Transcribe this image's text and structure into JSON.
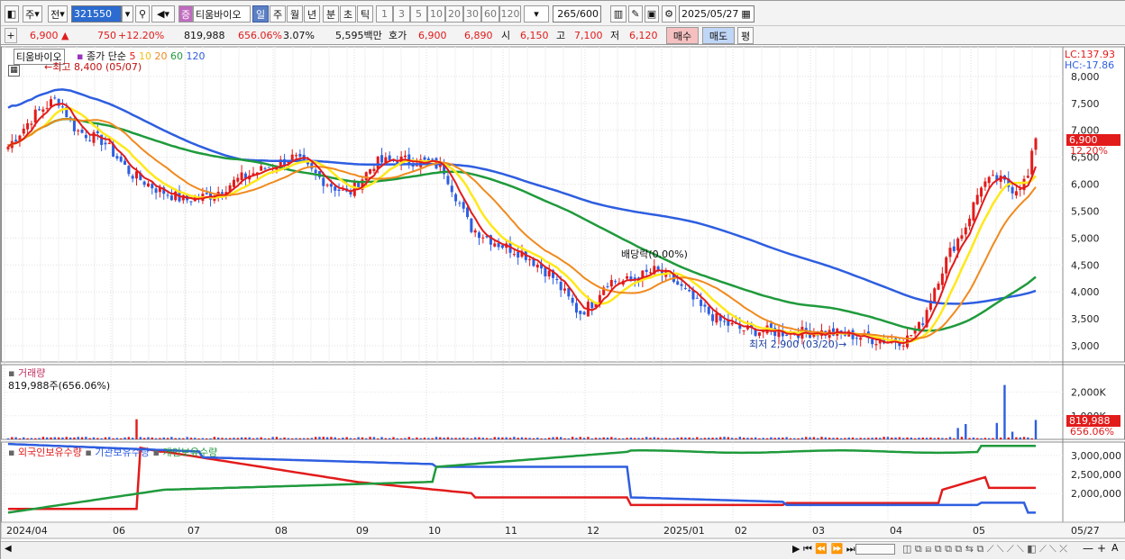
{
  "toolbar": {
    "type_label": "주",
    "period_label": "전",
    "code": "321550",
    "stock_name": "티움바이오",
    "badge": "증",
    "tf_day": "일",
    "tf_week": "주",
    "tf_month": "월",
    "tf_year": "년",
    "tf_min": "분",
    "tf_sec": "초",
    "tf_tick": "틱",
    "intervals": [
      "1",
      "3",
      "5",
      "10",
      "20",
      "30",
      "60",
      "120"
    ],
    "count": "265",
    "count_total": "/600",
    "date": "2025/05/27"
  },
  "quote": {
    "price": "6,900",
    "arrow": "▲",
    "change": "750",
    "change_pct": "+12.20%",
    "volume": "819,988",
    "vol_pct": "656.06%",
    "turnover": "3.07%",
    "amount": "5,595백만",
    "hoga_label": "호가",
    "hoga_ask": "6,900",
    "hoga_bid": "6,890",
    "open_label": "시",
    "open": "6,150",
    "high_label": "고",
    "high": "7,100",
    "low_label": "저",
    "low": "6,120",
    "buy_label": "매수",
    "sell_label": "매도",
    "eval_label": "평"
  },
  "price_panel": {
    "name": "티움바이오",
    "ma_label": "종가 단순",
    "ma_periods": [
      "5",
      "10",
      "20",
      "60",
      "120"
    ],
    "high_note": "최고 8,400 (05/07)",
    "low_note": "최저 2,900 (03/20)",
    "div_note": "배당락(0.00%)",
    "lc": "LC:137.93",
    "hc": "HC:-17.86",
    "cur_price": "6,900",
    "cur_pct": "12.20%",
    "ticks": [
      "8,000",
      "7,500",
      "7,000",
      "6,500",
      "6,000",
      "5,500",
      "5,000",
      "4,500",
      "4,000",
      "3,500",
      "3,000"
    ]
  },
  "volume_panel": {
    "title": "거래량",
    "value": "819,988주(656.06%)",
    "ticks": [
      "2,000K",
      "1,000K"
    ],
    "cur": "819,988",
    "cur_pct": "656.06%"
  },
  "holding_panel": {
    "series": [
      "외국인보유수량",
      "기관보유수량",
      "개인보유수량"
    ],
    "ticks": [
      "3,000,000",
      "2,500,000",
      "2,000,000"
    ]
  },
  "x_axis": {
    "labels": [
      "2024/04",
      "06",
      "07",
      "08",
      "09",
      "10",
      "11",
      "12",
      "2025/01",
      "02",
      "03",
      "04",
      "05"
    ],
    "end": "05/27"
  },
  "colors": {
    "red": "#e21b1b",
    "blue": "#2e5ee0",
    "green": "#1f9a3c",
    "yellow": "#ffe81a",
    "orange": "#f08a1e",
    "purple": "#9a33c0"
  }
}
